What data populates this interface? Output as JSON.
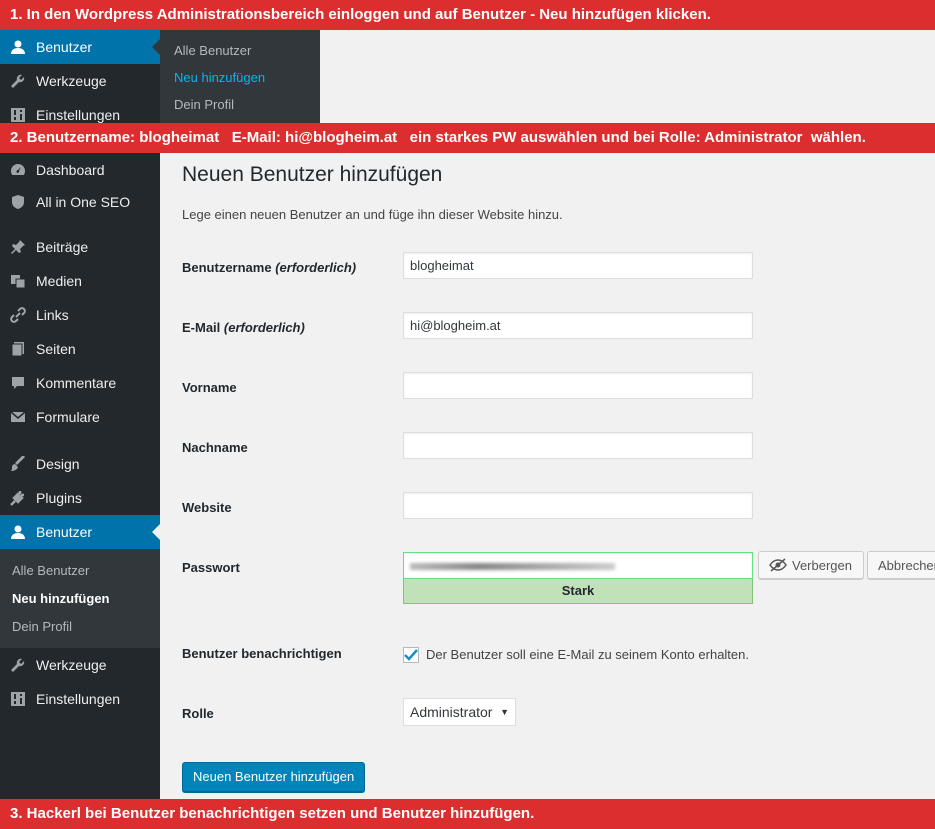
{
  "banners": {
    "step1": "1. In den Wordpress Administrationsbereich einloggen und auf Benutzer - Neu hinzufügen klicken.",
    "step2": "2. Benutzername: blogheimat   E-Mail: hi@blogheim.at   ein starkes PW auswählen und bei Rolle: Administrator  wählen.",
    "step3": "3. Hackerl bei Benutzer benachrichtigen setzen und Benutzer hinzufügen."
  },
  "top_menu": {
    "items": [
      {
        "label": "Benutzer",
        "icon": "user-icon"
      },
      {
        "label": "Werkzeuge",
        "icon": "wrench-icon"
      },
      {
        "label": "Einstellungen",
        "icon": "settings-icon"
      }
    ],
    "submenu": [
      "Alle Benutzer",
      "Neu hinzufügen",
      "Dein Profil"
    ]
  },
  "sidebar": {
    "items": [
      {
        "label": "Dashboard",
        "icon": "dashboard-icon"
      },
      {
        "label": "All in One SEO",
        "icon": "shield-icon"
      },
      {
        "label": "Beiträge",
        "icon": "pin-icon"
      },
      {
        "label": "Medien",
        "icon": "media-icon"
      },
      {
        "label": "Links",
        "icon": "link-icon"
      },
      {
        "label": "Seiten",
        "icon": "pages-icon"
      },
      {
        "label": "Kommentare",
        "icon": "comment-icon"
      },
      {
        "label": "Formulare",
        "icon": "mail-icon"
      },
      {
        "label": "Design",
        "icon": "brush-icon"
      },
      {
        "label": "Plugins",
        "icon": "plugin-icon"
      },
      {
        "label": "Benutzer",
        "icon": "user-icon"
      },
      {
        "label": "Werkzeuge",
        "icon": "wrench-icon"
      },
      {
        "label": "Einstellungen",
        "icon": "settings-icon"
      }
    ],
    "submenu": [
      "Alle Benutzer",
      "Neu hinzufügen",
      "Dein Profil"
    ]
  },
  "form": {
    "title": "Neuen Benutzer hinzufügen",
    "description": "Lege einen neuen Benutzer an und füge ihn dieser Website hinzu.",
    "username_label": "Benutzername",
    "email_label": "E-Mail",
    "required": "(erforderlich)",
    "firstname_label": "Vorname",
    "lastname_label": "Nachname",
    "website_label": "Website",
    "password_label": "Passwort",
    "notify_label": "Benutzer benachrichtigen",
    "role_label": "Rolle",
    "username_value": "blogheimat",
    "email_value": "hi@blogheim.at",
    "firstname_value": "",
    "lastname_value": "",
    "website_value": "",
    "strength": "Stark",
    "hide_button": "Verbergen",
    "cancel_button": "Abbrechen",
    "notify_text": "Der Benutzer soll eine E-Mail zu seinem Konto erhalten.",
    "notify_checked": true,
    "role_value": "Administrator",
    "submit_button": "Neuen Benutzer hinzufügen"
  },
  "colors": {
    "banner": "#dc2e2e",
    "sidebar": "#23282d",
    "active": "#0073aa",
    "primary": "#0085ba"
  }
}
